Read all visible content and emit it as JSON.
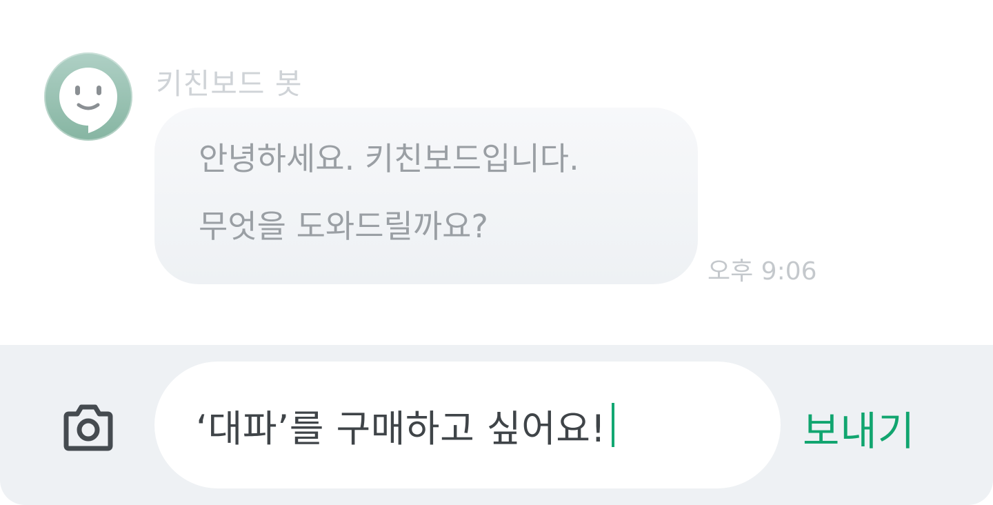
{
  "chat": {
    "bot_name": "키친보드 봇",
    "message_lines": [
      "안녕하세요. 키친보드입니다.",
      "무엇을 도와드릴까요?"
    ],
    "timestamp": "오후 9:06",
    "avatar_icon": "smiley-chat-bubble-icon"
  },
  "composer": {
    "input_value": "‘대파’를 구매하고 싶어요!",
    "send_label": "보내기",
    "camera_icon": "camera-icon",
    "accent_color": "#11a56f"
  },
  "colors": {
    "bubble_bg": "#f3f5f7",
    "input_bar_bg": "#eef1f4",
    "avatar": "#9cc4b5"
  }
}
